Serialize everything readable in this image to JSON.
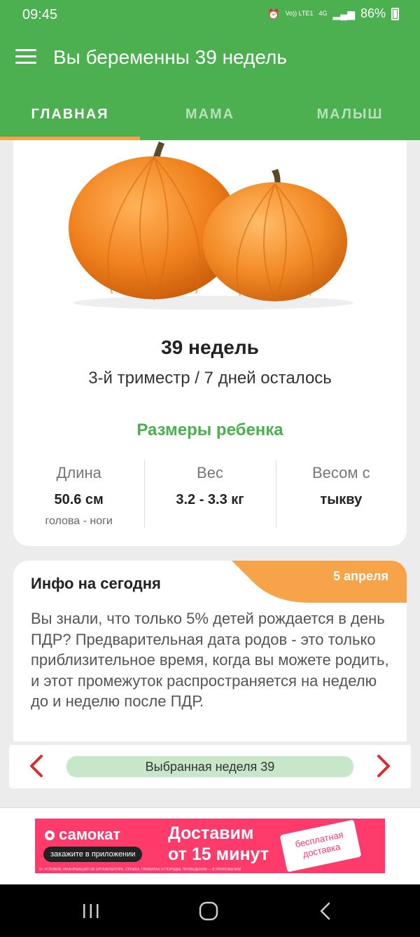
{
  "status_bar": {
    "time": "09:45",
    "alarm_icon": "alarm-icon",
    "volte_label": "Vo)) LTE1",
    "network_label": "4G",
    "battery_percent": "86%"
  },
  "app_bar": {
    "title": "Вы беременны 39 недель"
  },
  "tabs": [
    {
      "label": "ГЛАВНАЯ",
      "active": true
    },
    {
      "label": "МАМА",
      "active": false
    },
    {
      "label": "МАЛЫШ",
      "active": false
    }
  ],
  "main_card": {
    "week_title": "39 недель",
    "week_subtitle": "3-й триместр / 7 дней осталось",
    "sizes_title": "Размеры ребенка",
    "metrics": [
      {
        "label": "Длина",
        "value": "50.6 см",
        "note": "голова - ноги"
      },
      {
        "label": "Вес",
        "value": "3.2 - 3.3 кг",
        "note": ""
      },
      {
        "label": "Весом с",
        "value": "тыкву",
        "note": ""
      }
    ]
  },
  "info_card": {
    "title": "Инфо на сегодня",
    "date": "5 апреля",
    "body": "Вы знали, что только 5% детей рождается в день ПДР? Предварительная дата родов - это только приблизительное время, когда вы можете родить, и этот промежуток распространяется на неделю до и неделю после ПДР."
  },
  "week_selector": {
    "label": "Выбранная неделя 39"
  },
  "ad": {
    "brand": "самокат",
    "pill": "закажите в приложении",
    "headline_line1": "Доставим",
    "headline_line2": "от 15 минут",
    "badge_line1": "бесплатная",
    "badge_line2": "доставка",
    "fine_print": "6+ УСЛОВИЯ, ИНФОРМАЦИЯ ОБ ОРГАНИЗАТОРЕ, СРОКАХ, ПРАВИЛАХ И ПОРЯДКЕ ПРОВЕДЕНИЯ — В ПРИЛОЖЕНИИ"
  },
  "colors": {
    "primary_green": "#4caf50",
    "accent_orange": "#f6a34a",
    "ad_pink": "#ff3b6b",
    "arrow_red": "#d32f2f"
  }
}
